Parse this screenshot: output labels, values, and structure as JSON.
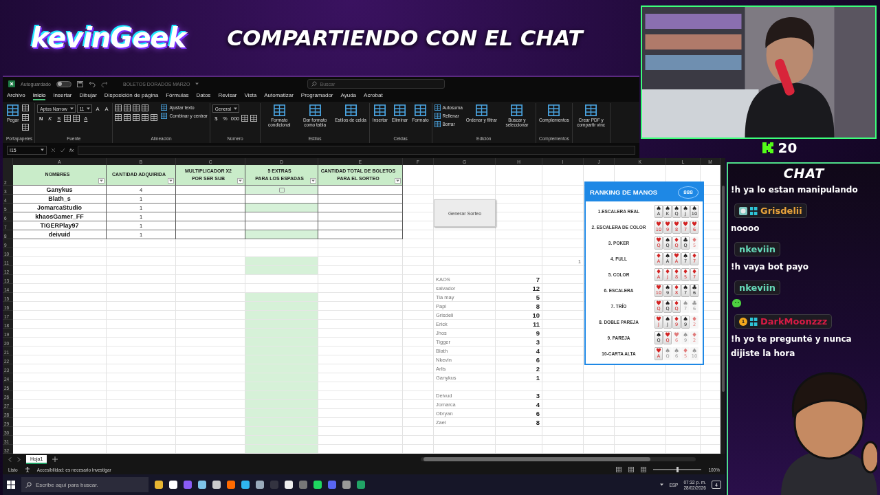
{
  "header": {
    "logo": "kevinGeek",
    "title": "COMPARTIENDO CON EL CHAT"
  },
  "webcam": {
    "kind": "picture",
    "follower_count": "20"
  },
  "excel": {
    "titlebar": {
      "autosave_label": "Autoguardado",
      "autosave_on": false,
      "file_name": "BOLETOS DORADOS MARZO",
      "search_placeholder": "Buscar"
    },
    "menu_tabs": [
      {
        "label": "Archivo",
        "selected": false
      },
      {
        "label": "Inicio",
        "selected": true
      },
      {
        "label": "Insertar",
        "selected": false
      },
      {
        "label": "Dibujar",
        "selected": false
      },
      {
        "label": "Disposición de página",
        "selected": false
      },
      {
        "label": "Fórmulas",
        "selected": false
      },
      {
        "label": "Datos",
        "selected": false
      },
      {
        "label": "Revisar",
        "selected": false
      },
      {
        "label": "Vista",
        "selected": false
      },
      {
        "label": "Automatizar",
        "selected": false
      },
      {
        "label": "Programador",
        "selected": false
      },
      {
        "label": "Ayuda",
        "selected": false
      },
      {
        "label": "Acrobat",
        "selected": false
      }
    ],
    "ribbon_groups": [
      {
        "label": "Portapapeles",
        "columns": [
          [
            [
              {
                "kind": "large",
                "label": "Pegar"
              }
            ]
          ],
          [
            [
              {
                "kind": "icon"
              }
            ],
            [
              {
                "kind": "icon"
              }
            ],
            [
              {
                "kind": "icon"
              }
            ]
          ]
        ]
      },
      {
        "label": "Fuente",
        "columns": [
          [
            [
              {
                "kind": "select",
                "value": "Aptos Narrow"
              },
              {
                "kind": "select",
                "value": "11"
              },
              {
                "kind": "glyph",
                "label": "A"
              },
              {
                "kind": "glyph",
                "label": "A"
              }
            ],
            [
              {
                "kind": "bold",
                "label": "N"
              },
              {
                "kind": "italic",
                "label": "K"
              },
              {
                "kind": "underline",
                "label": "S"
              },
              {
                "kind": "icon"
              },
              {
                "kind": "icon"
              },
              {
                "kind": "underline",
                "label": "A"
              }
            ]
          ]
        ]
      },
      {
        "label": "Alineación",
        "columns": [
          [
            [
              {
                "kind": "icon"
              },
              {
                "kind": "icon"
              },
              {
                "kind": "icon"
              },
              {
                "kind": "icon"
              }
            ],
            [
              {
                "kind": "icon"
              },
              {
                "kind": "icon"
              },
              {
                "kind": "icon"
              },
              {
                "kind": "icon"
              },
              {
                "kind": "icon"
              }
            ]
          ],
          [
            [
              {
                "kind": "small",
                "label": "Ajustar texto"
              }
            ],
            [
              {
                "kind": "small",
                "label": "Combinar y centrar"
              }
            ]
          ]
        ]
      },
      {
        "label": "Número",
        "columns": [
          [
            [
              {
                "kind": "select",
                "value": "General"
              }
            ],
            [
              {
                "kind": "glyph",
                "label": "$"
              },
              {
                "kind": "glyph",
                "label": "%"
              },
              {
                "kind": "glyph",
                "label": "000"
              },
              {
                "kind": "icon"
              },
              {
                "kind": "icon"
              }
            ]
          ]
        ]
      },
      {
        "label": "Estilos",
        "columns": [
          [
            [
              {
                "kind": "large",
                "label": "Formato condicional"
              }
            ]
          ],
          [
            [
              {
                "kind": "large",
                "label": "Dar formato como tabla"
              }
            ]
          ],
          [
            [
              {
                "kind": "large",
                "label": "Estilos de celda"
              }
            ]
          ]
        ]
      },
      {
        "label": "Celdas",
        "columns": [
          [
            [
              {
                "kind": "large",
                "label": "Insertar"
              }
            ]
          ],
          [
            [
              {
                "kind": "large",
                "label": "Eliminar"
              }
            ]
          ],
          [
            [
              {
                "kind": "large",
                "label": "Formato"
              }
            ]
          ]
        ]
      },
      {
        "label": "Edición",
        "columns": [
          [
            [
              {
                "kind": "small",
                "label": "Autosuma"
              }
            ],
            [
              {
                "kind": "small",
                "label": "Rellenar"
              }
            ],
            [
              {
                "kind": "small",
                "label": "Borrar"
              }
            ]
          ],
          [
            [
              {
                "kind": "large",
                "label": "Ordenar y filtrar"
              }
            ]
          ],
          [
            [
              {
                "kind": "large",
                "label": "Buscar y seleccionar"
              }
            ]
          ]
        ]
      },
      {
        "label": "Complementos",
        "columns": [
          [
            [
              {
                "kind": "large",
                "label": "Complementos"
              }
            ]
          ]
        ]
      },
      {
        "columns": [
          [
            [
              {
                "kind": "large",
                "label": "Crear PDF y compartir vínc"
              }
            ]
          ]
        ]
      }
    ],
    "formula_bar": {
      "name_box": "I15",
      "fx": "fx"
    },
    "sheet": {
      "columns": [
        "A",
        "B",
        "C",
        "D",
        "E",
        "F",
        "G",
        "H",
        "I",
        "J",
        "K",
        "L",
        "M"
      ],
      "header_row": {
        "number": "2",
        "cells": [
          "NOMBRES",
          "CANTIDAD ADQUIRIDA",
          "MULTIPLICADOR X2\nPOR SER SUB",
          "5 EXTRAS\nPARA LOS ESPADAS",
          "CANTIDAD TOTAL DE BOLETOS\nPARA EL SORTEO"
        ]
      },
      "rows": [
        {
          "number": "3",
          "name": "Ganykus",
          "quantity": "4",
          "highlighted": true,
          "checkbox": {
            "checked": false
          }
        },
        {
          "number": "4",
          "name": "Blath_s",
          "quantity": "1",
          "highlighted": false
        },
        {
          "number": "5",
          "name": "JomarcaStudio",
          "quantity": "1",
          "highlighted": true
        },
        {
          "number": "6",
          "name": "khaosGamer_FF",
          "quantity": "1",
          "highlighted": false
        },
        {
          "number": "7",
          "name": "TIGERPlay97",
          "quantity": "1",
          "highlighted": false
        },
        {
          "number": "8",
          "name": "deivuid",
          "quantity": "1",
          "highlighted": true
        },
        {
          "number": "9",
          "highlighted": false
        },
        {
          "number": "10",
          "highlighted": false
        },
        {
          "number": "11",
          "highlighted": true,
          "side_value": "1"
        },
        {
          "number": "12",
          "highlighted": true
        },
        {
          "number": "13",
          "highlighted": false,
          "list_name": "KAOS",
          "list_value": "7"
        },
        {
          "number": "14",
          "highlighted": false,
          "list_name": "salvador",
          "list_value": "12"
        },
        {
          "number": "15",
          "highlighted": true,
          "list_name": "Tia may",
          "list_value": "5"
        },
        {
          "number": "16",
          "highlighted": true,
          "list_name": "Papi",
          "list_value": "8"
        },
        {
          "number": "17",
          "highlighted": true,
          "list_name": "Grisdeli",
          "list_value": "10"
        },
        {
          "number": "18",
          "highlighted": true,
          "list_name": "Erick",
          "list_value": "11"
        },
        {
          "number": "19",
          "highlighted": true,
          "list_name": "Jhos",
          "list_value": "9"
        },
        {
          "number": "20",
          "highlighted": true,
          "list_name": "Tigger",
          "list_value": "3"
        },
        {
          "number": "21",
          "highlighted": true,
          "list_name": "Blath",
          "list_value": "4"
        },
        {
          "number": "22",
          "highlighted": true,
          "list_name": "Nkevin",
          "list_value": "6"
        },
        {
          "number": "23",
          "highlighted": true,
          "list_name": "Arlis",
          "list_value": "2"
        },
        {
          "number": "24",
          "highlighted": true,
          "list_name": "Ganykus",
          "list_value": "1"
        },
        {
          "number": "25",
          "highlighted": true
        },
        {
          "number": "26",
          "highlighted": true,
          "list_name": "Deivud",
          "list_value": "3"
        },
        {
          "number": "27",
          "highlighted": true,
          "list_name": "Jomarca",
          "list_value": "4"
        },
        {
          "number": "28",
          "highlighted": true,
          "list_name": "Obryan",
          "list_value": "6"
        },
        {
          "number": "29",
          "highlighted": true,
          "list_name": "Zael",
          "list_value": "8"
        },
        {
          "number": "30",
          "highlighted": true
        },
        {
          "number": "31",
          "highlighted": true
        },
        {
          "number": "32",
          "highlighted": true
        }
      ],
      "button": "Generar Sorteo",
      "ranking": {
        "title": "RANKING DE MANOS",
        "logo": "888",
        "hands": [
          {
            "label": "1.ESCALERA REAL",
            "cards": [
              {
                "suit": "♠",
                "rank": "A",
                "color": "#222222",
                "in_hand": true
              },
              {
                "suit": "♠",
                "rank": "K",
                "color": "#222222",
                "in_hand": true
              },
              {
                "suit": "♠",
                "rank": "Q",
                "color": "#222222",
                "in_hand": true
              },
              {
                "suit": "♠",
                "rank": "J",
                "color": "#222222",
                "in_hand": true
              },
              {
                "suit": "♠",
                "rank": "10",
                "color": "#222222",
                "in_hand": true
              }
            ]
          },
          {
            "label": "2. ESCALERA DE COLOR",
            "cards": [
              {
                "suit": "♥",
                "rank": "10",
                "color": "#d22222",
                "in_hand": true
              },
              {
                "suit": "♥",
                "rank": "9",
                "color": "#d22222",
                "in_hand": true
              },
              {
                "suit": "♥",
                "rank": "8",
                "color": "#d22222",
                "in_hand": true
              },
              {
                "suit": "♥",
                "rank": "7",
                "color": "#d22222",
                "in_hand": true
              },
              {
                "suit": "♥",
                "rank": "6",
                "color": "#d22222",
                "in_hand": true
              }
            ]
          },
          {
            "label": "3. POKER",
            "cards": [
              {
                "suit": "♥",
                "rank": "Q",
                "color": "#d22222",
                "in_hand": true
              },
              {
                "suit": "♠",
                "rank": "Q",
                "color": "#222222",
                "in_hand": true
              },
              {
                "suit": "♦",
                "rank": "Q",
                "color": "#d22222",
                "in_hand": true
              },
              {
                "suit": "♣",
                "rank": "Q",
                "color": "#222222",
                "in_hand": true
              },
              {
                "suit": "♦",
                "rank": "5",
                "color": "#e07a7a",
                "in_hand": false
              }
            ]
          },
          {
            "label": "4. FULL",
            "cards": [
              {
                "suit": "♦",
                "rank": "A",
                "color": "#d22222",
                "in_hand": true
              },
              {
                "suit": "♠",
                "rank": "A",
                "color": "#222222",
                "in_hand": true
              },
              {
                "suit": "♥",
                "rank": "A",
                "color": "#d22222",
                "in_hand": true
              },
              {
                "suit": "♠",
                "rank": "7",
                "color": "#222222",
                "in_hand": true
              },
              {
                "suit": "♦",
                "rank": "7",
                "color": "#d22222",
                "in_hand": true
              }
            ]
          },
          {
            "label": "5. COLOR",
            "cards": [
              {
                "suit": "♦",
                "rank": "A",
                "color": "#d22222",
                "in_hand": true
              },
              {
                "suit": "♦",
                "rank": "J",
                "color": "#d22222",
                "in_hand": true
              },
              {
                "suit": "♦",
                "rank": "8",
                "color": "#d22222",
                "in_hand": true
              },
              {
                "suit": "♦",
                "rank": "5",
                "color": "#d22222",
                "in_hand": true
              },
              {
                "suit": "♦",
                "rank": "7",
                "color": "#d22222",
                "in_hand": true
              }
            ]
          },
          {
            "label": "6. ESCALERA",
            "cards": [
              {
                "suit": "♥",
                "rank": "10",
                "color": "#d22222",
                "in_hand": true
              },
              {
                "suit": "♠",
                "rank": "9",
                "color": "#222222",
                "in_hand": true
              },
              {
                "suit": "♦",
                "rank": "8",
                "color": "#d22222",
                "in_hand": true
              },
              {
                "suit": "♠",
                "rank": "7",
                "color": "#222222",
                "in_hand": true
              },
              {
                "suit": "♣",
                "rank": "6",
                "color": "#222222",
                "in_hand": true
              }
            ]
          },
          {
            "label": "7. TRÍO",
            "cards": [
              {
                "suit": "♥",
                "rank": "Q",
                "color": "#d22222",
                "in_hand": true
              },
              {
                "suit": "♠",
                "rank": "Q",
                "color": "#222222",
                "in_hand": true
              },
              {
                "suit": "♦",
                "rank": "Q",
                "color": "#d22222",
                "in_hand": true
              },
              {
                "suit": "♠",
                "rank": "7",
                "color": "#9a9a9a",
                "in_hand": false
              },
              {
                "suit": "♣",
                "rank": "6",
                "color": "#9a9a9a",
                "in_hand": false
              }
            ]
          },
          {
            "label": "8. DOBLE PAREJA",
            "cards": [
              {
                "suit": "♥",
                "rank": "J",
                "color": "#d22222",
                "in_hand": true
              },
              {
                "suit": "♠",
                "rank": "J",
                "color": "#222222",
                "in_hand": true
              },
              {
                "suit": "♦",
                "rank": "9",
                "color": "#d22222",
                "in_hand": true
              },
              {
                "suit": "♠",
                "rank": "9",
                "color": "#222222",
                "in_hand": true
              },
              {
                "suit": "♦",
                "rank": "2",
                "color": "#e07a7a",
                "in_hand": false
              }
            ]
          },
          {
            "label": "9. PAREJA",
            "cards": [
              {
                "suit": "♠",
                "rank": "Q",
                "color": "#222222",
                "in_hand": true
              },
              {
                "suit": "♥",
                "rank": "Q",
                "color": "#d22222",
                "in_hand": true
              },
              {
                "suit": "♥",
                "rank": "6",
                "color": "#e07a7a",
                "in_hand": false
              },
              {
                "suit": "♠",
                "rank": "9",
                "color": "#9a9a9a",
                "in_hand": false
              },
              {
                "suit": "♦",
                "rank": "2",
                "color": "#e07a7a",
                "in_hand": false
              }
            ]
          },
          {
            "label": "10-CARTA ALTA",
            "cards": [
              {
                "suit": "♥",
                "rank": "A",
                "color": "#d22222",
                "in_hand": true
              },
              {
                "suit": "♠",
                "rank": "Q",
                "color": "#9a9a9a",
                "in_hand": false
              },
              {
                "suit": "♠",
                "rank": "6",
                "color": "#9a9a9a",
                "in_hand": false
              },
              {
                "suit": "♦",
                "rank": "5",
                "color": "#e07a7a",
                "in_hand": false
              },
              {
                "suit": "♠",
                "rank": "10",
                "color": "#9a9a9a",
                "in_hand": false
              }
            ]
          }
        ]
      },
      "sheet_tabs": [
        {
          "label": "Hoja1",
          "selected": true
        }
      ]
    },
    "status_bar": {
      "status": "Listo",
      "accessibility": "Accesibilidad: es necesario investigar",
      "zoom": "100%",
      "zoom_level": {
        "level": 0.5
      }
    }
  },
  "taskbar": {
    "search_placeholder": "Escribe aquí para buscar.",
    "language": "ESP",
    "time": "07:32 p. m.",
    "date": "28/02/2026",
    "notifications": "4"
  },
  "chat": {
    "title": "CHAT",
    "messages": [
      {
        "kind": "text",
        "text": "!h ya lo estan manipulando"
      },
      {
        "kind": "text",
        "user": "Grisdelii",
        "color": "#e9a33b",
        "badges": [
          {
            "kind": "emote"
          },
          {
            "kind": "sub"
          }
        ],
        "text": "noooo"
      },
      {
        "kind": "text",
        "user": "nkeviin",
        "color": "#66d9b8",
        "text": "!h vaya bot payo"
      },
      {
        "kind": "emote",
        "user": "nkeviin",
        "color": "#66d9b8"
      },
      {
        "kind": "text",
        "user": "DarkMoonzzz",
        "color": "#d81b45",
        "badges": [
          {
            "kind": "coin",
            "text": "1"
          },
          {
            "kind": "sub"
          }
        ],
        "text": "!h yo te pregunté y nunca dijiste la hora"
      }
    ]
  }
}
